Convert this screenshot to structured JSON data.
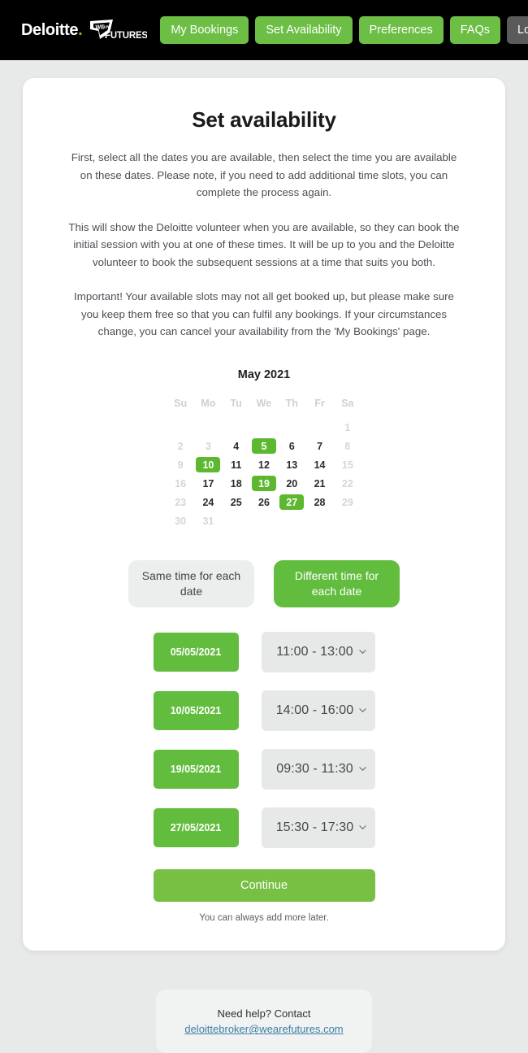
{
  "navbar": {
    "brand_primary": "Deloitte",
    "brand_dot": ".",
    "brand_secondary_top": "WE ARE",
    "brand_secondary_main": "FUTURES",
    "links": [
      {
        "label": "My Bookings",
        "style": "green"
      },
      {
        "label": "Set Availability",
        "style": "green"
      },
      {
        "label": "Preferences",
        "style": "green"
      },
      {
        "label": "FAQs",
        "style": "green"
      },
      {
        "label": "Logout",
        "style": "grey"
      }
    ],
    "background": "#000000",
    "accent": "#6cbe45",
    "logout_color": "#5a5a5a"
  },
  "page": {
    "title": "Set availability",
    "paragraphs": [
      "First, select all the dates you are available, then select the time you are available on these dates. Please note, if you need to add additional time slots, you can complete the process again.",
      "This will show the Deloitte volunteer when you are available, so they can book the initial session with you at one of these times. It will be up to you and the Deloitte volunteer to book the subsequent sessions at a time that suits you both.",
      "Important! Your available slots may not all get booked up, but please make sure you keep them free so that you can fulfil any bookings. If your circumstances change, you can cancel your availability from the 'My Bookings' page."
    ]
  },
  "calendar": {
    "month_label": "May 2021",
    "weekdays": [
      "Su",
      "Mo",
      "Tu",
      "We",
      "Th",
      "Fr",
      "Sa"
    ],
    "selected_color": "#5cb82e",
    "weeks": [
      [
        {
          "label": "",
          "state": "empty"
        },
        {
          "label": "",
          "state": "empty"
        },
        {
          "label": "",
          "state": "empty"
        },
        {
          "label": "",
          "state": "empty"
        },
        {
          "label": "",
          "state": "empty"
        },
        {
          "label": "",
          "state": "empty"
        },
        {
          "label": "1",
          "state": "muted"
        }
      ],
      [
        {
          "label": "2",
          "state": "muted"
        },
        {
          "label": "3",
          "state": "muted"
        },
        {
          "label": "4",
          "state": "normal"
        },
        {
          "label": "5",
          "state": "selected"
        },
        {
          "label": "6",
          "state": "normal"
        },
        {
          "label": "7",
          "state": "normal"
        },
        {
          "label": "8",
          "state": "muted"
        }
      ],
      [
        {
          "label": "9",
          "state": "muted"
        },
        {
          "label": "10",
          "state": "selected"
        },
        {
          "label": "11",
          "state": "normal"
        },
        {
          "label": "12",
          "state": "normal"
        },
        {
          "label": "13",
          "state": "normal"
        },
        {
          "label": "14",
          "state": "normal"
        },
        {
          "label": "15",
          "state": "muted"
        }
      ],
      [
        {
          "label": "16",
          "state": "muted"
        },
        {
          "label": "17",
          "state": "normal"
        },
        {
          "label": "18",
          "state": "normal"
        },
        {
          "label": "19",
          "state": "selected"
        },
        {
          "label": "20",
          "state": "normal"
        },
        {
          "label": "21",
          "state": "normal"
        },
        {
          "label": "22",
          "state": "muted"
        }
      ],
      [
        {
          "label": "23",
          "state": "muted"
        },
        {
          "label": "24",
          "state": "normal"
        },
        {
          "label": "25",
          "state": "normal"
        },
        {
          "label": "26",
          "state": "normal"
        },
        {
          "label": "27",
          "state": "selected"
        },
        {
          "label": "28",
          "state": "normal"
        },
        {
          "label": "29",
          "state": "muted"
        }
      ],
      [
        {
          "label": "30",
          "state": "muted"
        },
        {
          "label": "31",
          "state": "muted"
        },
        {
          "label": "",
          "state": "empty"
        },
        {
          "label": "",
          "state": "empty"
        },
        {
          "label": "",
          "state": "empty"
        },
        {
          "label": "",
          "state": "empty"
        },
        {
          "label": "",
          "state": "empty"
        }
      ]
    ]
  },
  "mode_toggle": {
    "same_label": "Same time for each date",
    "different_label": "Different time for each date",
    "selected": "different"
  },
  "slots": [
    {
      "date": "05/05/2021",
      "time": "11:00 - 13:00"
    },
    {
      "date": "10/05/2021",
      "time": "14:00 - 16:00"
    },
    {
      "date": "19/05/2021",
      "time": "09:30 - 11:30"
    },
    {
      "date": "27/05/2021",
      "time": "15:30 - 17:30"
    }
  ],
  "actions": {
    "continue_label": "Continue",
    "note": "You can always add more later."
  },
  "help": {
    "line": "Need help? Contact",
    "email": "deloittebroker@wearefutures.com"
  }
}
